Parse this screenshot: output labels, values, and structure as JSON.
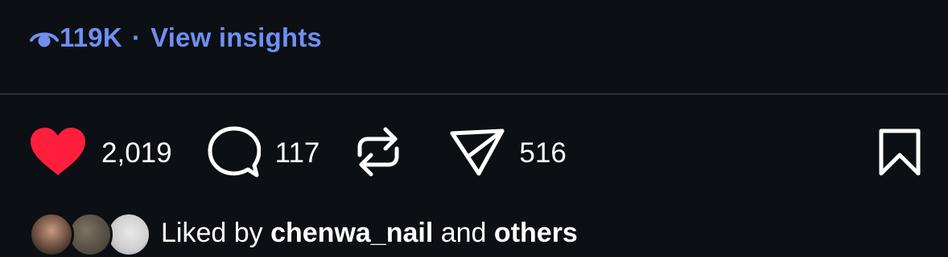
{
  "insights": {
    "views": "119K",
    "separator": "·",
    "link_label": "View insights",
    "accent_color": "#6f8ff2",
    "icon": "eye-icon"
  },
  "actions": {
    "like": {
      "icon": "heart-filled-icon",
      "count": "2,019",
      "color": "#ff1f3d"
    },
    "comment": {
      "icon": "comment-bubble-icon",
      "count": "117"
    },
    "repost": {
      "icon": "repost-icon"
    },
    "share": {
      "icon": "paper-plane-icon",
      "count": "516"
    },
    "save": {
      "icon": "bookmark-icon"
    }
  },
  "liked_by": {
    "prefix": "Liked by ",
    "user": "chenwa_nail",
    "conjunction": " and ",
    "others": "others",
    "avatars": [
      "avatar-1",
      "avatar-2",
      "avatar-3"
    ]
  }
}
